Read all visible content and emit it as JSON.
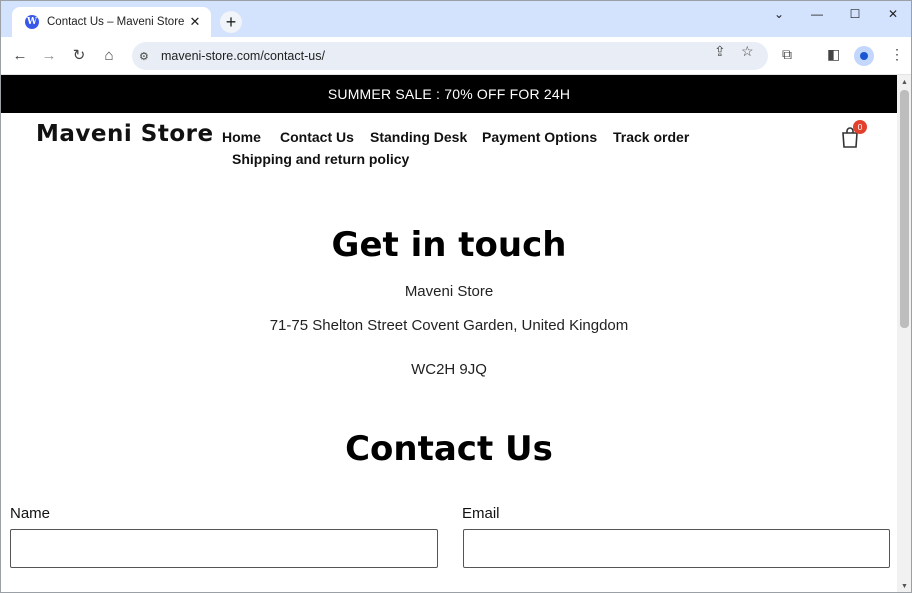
{
  "browser": {
    "tab_title": "Contact Us – Maveni Store",
    "favicon": "W",
    "url": "maveni-store.com/contact-us/",
    "icons": [
      "back-icon",
      "forward-icon",
      "reload-icon",
      "home-icon",
      "site-info-icon",
      "share-icon",
      "star-icon",
      "extensions-icon",
      "side-panel-icon",
      "profile-icon",
      "menu-icon"
    ]
  },
  "page": {
    "announcement": "SUMMER SALE : 70% OFF FOR 24H",
    "logo": "Maveni Store",
    "nav": {
      "home": "Home",
      "contact": "Contact Us",
      "standing_desk": "Standing Desk",
      "payment": "Payment Options",
      "track": "Track order",
      "shipping": "Shipping and return policy"
    },
    "cart_count": "0",
    "get_in_touch": {
      "title": "Get in touch",
      "company": "Maveni Store",
      "street": "71-75 Shelton Street Covent Garden, United Kingdom",
      "postcode": "WC2H 9JQ"
    },
    "contact_form": {
      "title": "Contact Us",
      "name_label": "Name",
      "email_label": "Email",
      "name_value": "",
      "email_value": ""
    }
  },
  "colors": {
    "tabstrip": "#d3e3fd",
    "announcement_bg": "#000000",
    "cart_badge": "#e2412d"
  }
}
